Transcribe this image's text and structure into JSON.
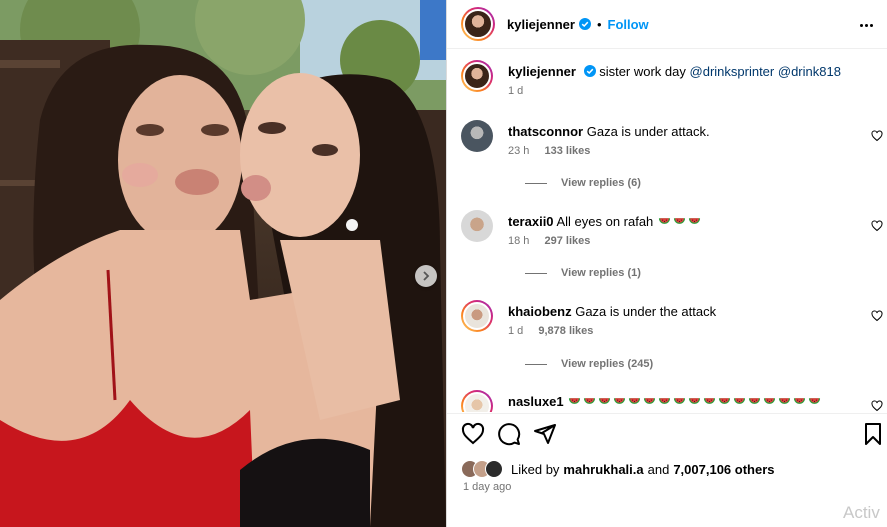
{
  "post": {
    "author": "kyliejenner",
    "separator": "•",
    "follow_label": "Follow",
    "caption": {
      "author": "kyliejenner",
      "text": "sister work day",
      "mentions": [
        "@drinksprinter",
        "@drink818"
      ],
      "age": "1 d"
    }
  },
  "comments": [
    {
      "user": "thatsconnor",
      "text": "Gaza is under attack.",
      "age": "23 h",
      "likes": "133 likes",
      "replies": "View replies (6)",
      "emojis": 0
    },
    {
      "user": "teraxii0",
      "text": "All eyes on rafah",
      "age": "18 h",
      "likes": "297 likes",
      "replies": "View replies (1)",
      "emojis": 3
    },
    {
      "user": "khaiobenz",
      "text": "Gaza is under the attack",
      "age": "1 d",
      "likes": "9,878 likes",
      "replies": "View replies (245)",
      "emojis": 0
    },
    {
      "user": "nasluxe1",
      "text": "",
      "age": "",
      "likes": "",
      "replies": "",
      "emojis": 17
    }
  ],
  "likes_bar": {
    "prefix": "Liked by",
    "user": "mahrukhali.a",
    "and_text": "and",
    "others": "7,007,106 others",
    "time": "1 day ago"
  },
  "icons": {
    "verified": "verified-badge-icon",
    "more": "more-options-icon",
    "like": "heart-icon",
    "comment": "comment-icon",
    "share": "send-icon",
    "save": "bookmark-icon",
    "carousel_next": "chevron-right-icon",
    "emoji": "watermelon-icon"
  },
  "colors": {
    "accent": "#0095f6",
    "mention": "#00376b",
    "muted": "#737373",
    "story_ring": [
      "#feda75",
      "#fa7e1e",
      "#d62976",
      "#962fbf"
    ]
  },
  "overlay": {
    "watermark": "Activ"
  }
}
